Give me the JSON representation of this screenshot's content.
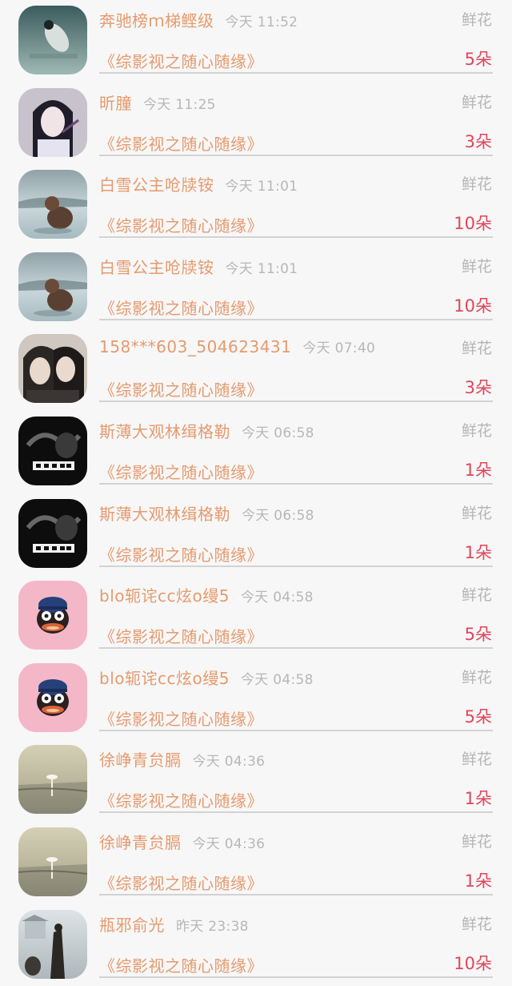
{
  "items": [
    {
      "user": "奔驰榜ｍ梯鲣级",
      "time": "今天 11:52",
      "gift": "鲜花",
      "book": "《综影视之随心随缘》",
      "count": "5朵",
      "avatar": "avatar-girl-floating"
    },
    {
      "user": "昕朣",
      "time": "今天 11:25",
      "gift": "鲜花",
      "book": "《综影视之随心随缘》",
      "count": "3朵",
      "avatar": "avatar-anime-girl"
    },
    {
      "user": "白雪公主呛牍铵",
      "time": "今天 11:01",
      "gift": "鲜花",
      "book": "《综影视之随心随缘》",
      "count": "10朵",
      "avatar": "avatar-dog-lake"
    },
    {
      "user": "白雪公主呛牍铵",
      "time": "今天 11:01",
      "gift": "鲜花",
      "book": "《综影视之随心随缘》",
      "count": "10朵",
      "avatar": "avatar-dog-lake"
    },
    {
      "user": "158***603_504623431",
      "time": "今天 07:40",
      "gift": "鲜花",
      "book": "《综影视之随心随缘》",
      "count": "3朵",
      "avatar": "avatar-two-men"
    },
    {
      "user": "斯薄大观林缉格勒",
      "time": "今天 06:58",
      "gift": "鲜花",
      "book": "《综影视之随心随缘》",
      "count": "1朵",
      "avatar": "avatar-smoke-dark"
    },
    {
      "user": "斯薄大观林缉格勒",
      "time": "今天 06:58",
      "gift": "鲜花",
      "book": "《综影视之随心随缘》",
      "count": "1朵",
      "avatar": "avatar-smoke-dark"
    },
    {
      "user": "blo轭诧cc炫o缦5",
      "time": "今天 04:58",
      "gift": "鲜花",
      "book": "《综影视之随心随缘》",
      "count": "5朵",
      "avatar": "avatar-monkey-pink"
    },
    {
      "user": "blo轭诧cc炫o缦5",
      "time": "今天 04:58",
      "gift": "鲜花",
      "book": "《综影视之随心随缘》",
      "count": "5朵",
      "avatar": "avatar-monkey-pink"
    },
    {
      "user": "徐峥青贠膈",
      "time": "今天 04:36",
      "gift": "鲜花",
      "book": "《综影视之随心随缘》",
      "count": "1朵",
      "avatar": "avatar-foggy-lake"
    },
    {
      "user": "徐峥青贠膈",
      "time": "今天 04:36",
      "gift": "鲜花",
      "book": "《综影视之随心随缘》",
      "count": "1朵",
      "avatar": "avatar-foggy-lake"
    },
    {
      "user": "瓶邪俞光",
      "time": "昨天 23:38",
      "gift": "鲜花",
      "book": "《综影视之随心随缘》",
      "count": "10朵",
      "avatar": "avatar-snow-figure"
    }
  ],
  "colors": {
    "username": "#e69a6e",
    "time": "#b7b7b7",
    "gift": "#b5b5b5",
    "count": "#e0465a",
    "divider": "#d3d3d3",
    "background": "#f7f7f7"
  }
}
